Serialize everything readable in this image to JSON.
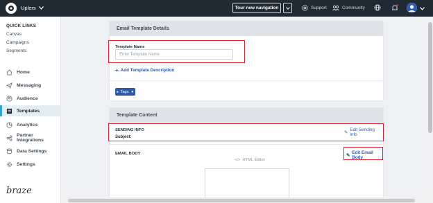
{
  "topbar": {
    "workspace": "Uplers",
    "tour_button": "Tour new navigation",
    "support": "Support",
    "community": "Community"
  },
  "sidebar": {
    "quick_links_title": "QUICK LINKS",
    "quick_links": [
      "Canvas",
      "Campaigns",
      "Segments"
    ],
    "nav": [
      {
        "label": "Home",
        "icon": "home-icon"
      },
      {
        "label": "Messaging",
        "icon": "send-icon"
      },
      {
        "label": "Audience",
        "icon": "audience-icon"
      },
      {
        "label": "Templates",
        "icon": "template-icon"
      },
      {
        "label": "Analytics",
        "icon": "analytics-icon"
      },
      {
        "label": "Partner Integrations",
        "icon": "integrations-icon"
      },
      {
        "label": "Data Settings",
        "icon": "data-icon"
      },
      {
        "label": "Settings",
        "icon": "gear-icon"
      }
    ],
    "active_index": 3,
    "brand": "braze"
  },
  "details": {
    "title": "Email Template Details",
    "name_label": "Template Name",
    "name_placeholder": "Enter Template Name",
    "add_description": "Add Template Description",
    "tags_button": "Tags"
  },
  "content": {
    "title": "Template Content",
    "sending_info_label": "SENDING INFO",
    "subject_label": "Subject:",
    "edit_sending_info": "Edit Sending Info",
    "email_body_label": "EMAIL BODY",
    "edit_email_body": "Edit Email Body",
    "editor_type": "HTML Editor"
  },
  "colors": {
    "topbar": "#1f2a33",
    "link": "#2c5aa8",
    "highlight": "#e0242d",
    "active_nav": "#2aa7d6"
  }
}
